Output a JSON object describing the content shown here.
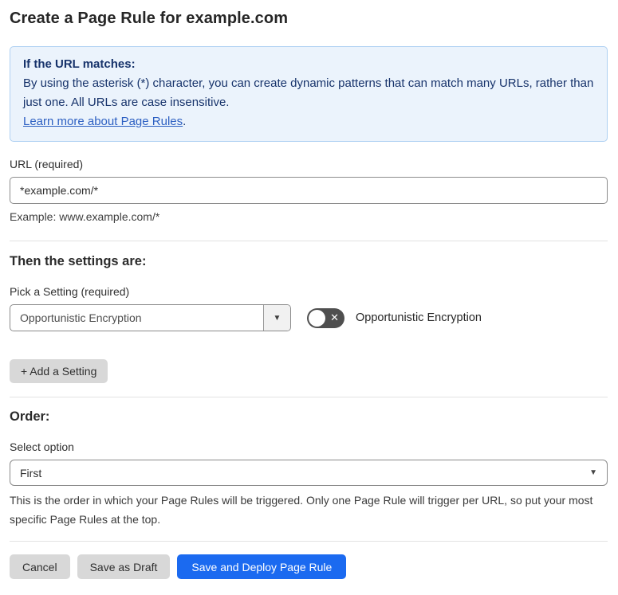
{
  "page": {
    "title": "Create a Page Rule for example.com"
  },
  "info_box": {
    "heading": "If the URL matches:",
    "body": "By using the asterisk (*) character, you can create dynamic patterns that can match many URLs, rather than just one. All URLs are case insensitive.",
    "link_label": "Learn more about Page Rules",
    "link_suffix": "."
  },
  "url_field": {
    "label": "URL (required)",
    "value": "*example.com/*",
    "example": "Example: www.example.com/*"
  },
  "settings_section": {
    "heading": "Then the settings are:",
    "picker_label": "Pick a Setting (required)",
    "picker_value": "Opportunistic Encryption",
    "dropdown_caret": "▼",
    "toggle": {
      "state": "off",
      "off_glyph": "✕",
      "label": "Opportunistic Encryption"
    },
    "add_button_label": "+ Add a Setting"
  },
  "order_section": {
    "heading": "Order:",
    "select_label": "Select option",
    "select_value": "First",
    "select_caret": "▼",
    "help_text": "This is the order in which your Page Rules will be triggered. Only one Page Rule will trigger per URL, so put your most specific Page Rules at the top."
  },
  "footer": {
    "cancel_label": "Cancel",
    "save_draft_label": "Save as Draft",
    "save_deploy_label": "Save and Deploy Page Rule"
  },
  "colors": {
    "primary_button": "#1b6af0",
    "info_background": "#ebf3fc",
    "info_border": "#aed0f2",
    "info_text": "#17336b",
    "link": "#2c5fc2",
    "toggle_off": "#4f4f4f"
  }
}
